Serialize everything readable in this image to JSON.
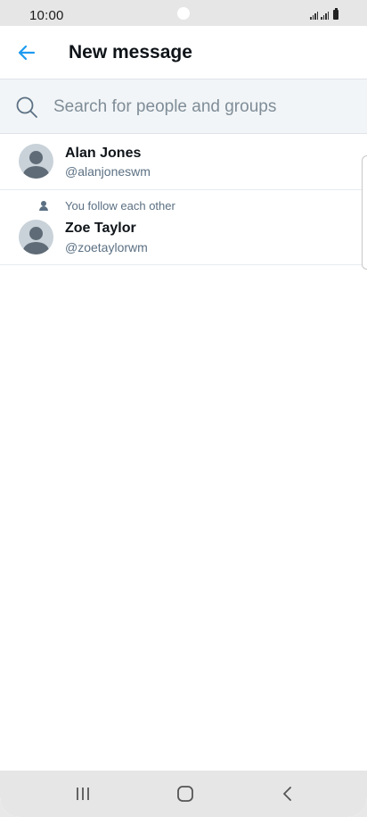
{
  "status_bar": {
    "time": "10:00"
  },
  "header": {
    "title": "New message",
    "back_icon": "arrow-left-icon",
    "accent_color": "#1d9bf0"
  },
  "search": {
    "placeholder": "Search for people and groups",
    "value": "",
    "icon": "search-icon"
  },
  "results": [
    {
      "name": "Alan Jones",
      "handle": "@alanjoneswm",
      "context": ""
    },
    {
      "name": "Zoe Taylor",
      "handle": "@zoetaylorwm",
      "context": "You follow each other"
    }
  ],
  "nav_bar": {
    "recent_icon": "recent-apps-icon",
    "home_icon": "home-icon",
    "back_icon": "back-icon"
  }
}
